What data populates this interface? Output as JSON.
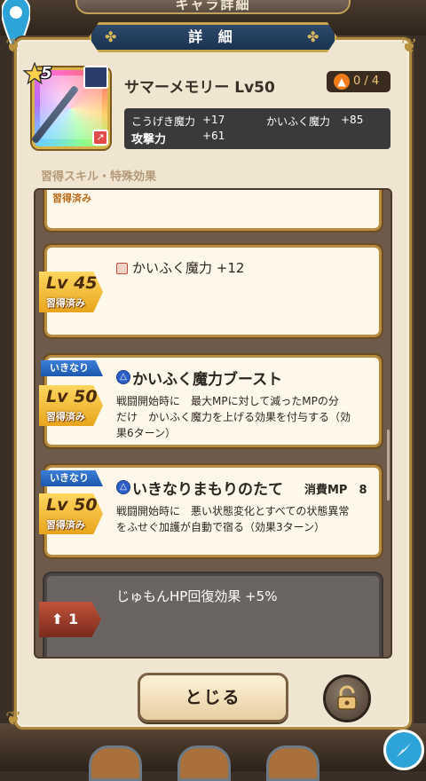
{
  "background_title": "キャラ詳細",
  "header": {
    "title": "詳 細"
  },
  "item": {
    "rarity": "5",
    "name": "サマーメモリー Lv50",
    "upgrade": "0 / 4"
  },
  "stats": {
    "row1_left_label": "こうげき魔力",
    "row1_left_value": "+17",
    "row1_right_label": "かいふく魔力",
    "row1_right_value": "+85",
    "row2_left_label": "攻撃力",
    "row2_left_value": "+61"
  },
  "section_label": "習得スキル・特殊効果",
  "cards": [
    {
      "status": "習得済み"
    },
    {
      "level": "Lv 45",
      "status": "習得済み",
      "title": "かいふく魔力 +12"
    },
    {
      "tag": "いきなり",
      "level": "Lv 50",
      "status": "習得済み",
      "title": "かいふく魔力ブースト",
      "desc1": "戦闘開始時に　最大MPに対して減ったMPの分",
      "desc2": "だけ　かいふく魔力を上げる効果を付与する（効",
      "desc3": "果6ターン）"
    },
    {
      "tag": "いきなり",
      "level": "Lv 50",
      "status": "習得済み",
      "title": "いきなりまもりのたて",
      "mp": "消費MP　8",
      "desc1": "戦闘開始時に　悪い状態変化とすべての状態異常",
      "desc2": "をふせぐ加護が自動で宿る（効果3ターン）"
    },
    {
      "upgrade_level": "1",
      "title": "じゅもんHP回復効果 +5%"
    }
  ],
  "buttons": {
    "close": "とじる"
  },
  "colors": {
    "panel": "#efe5d0",
    "gold": "#b88d3f",
    "banner": "#1b3350",
    "badge": "#e8a51c",
    "sudden": "#1d58ad"
  }
}
